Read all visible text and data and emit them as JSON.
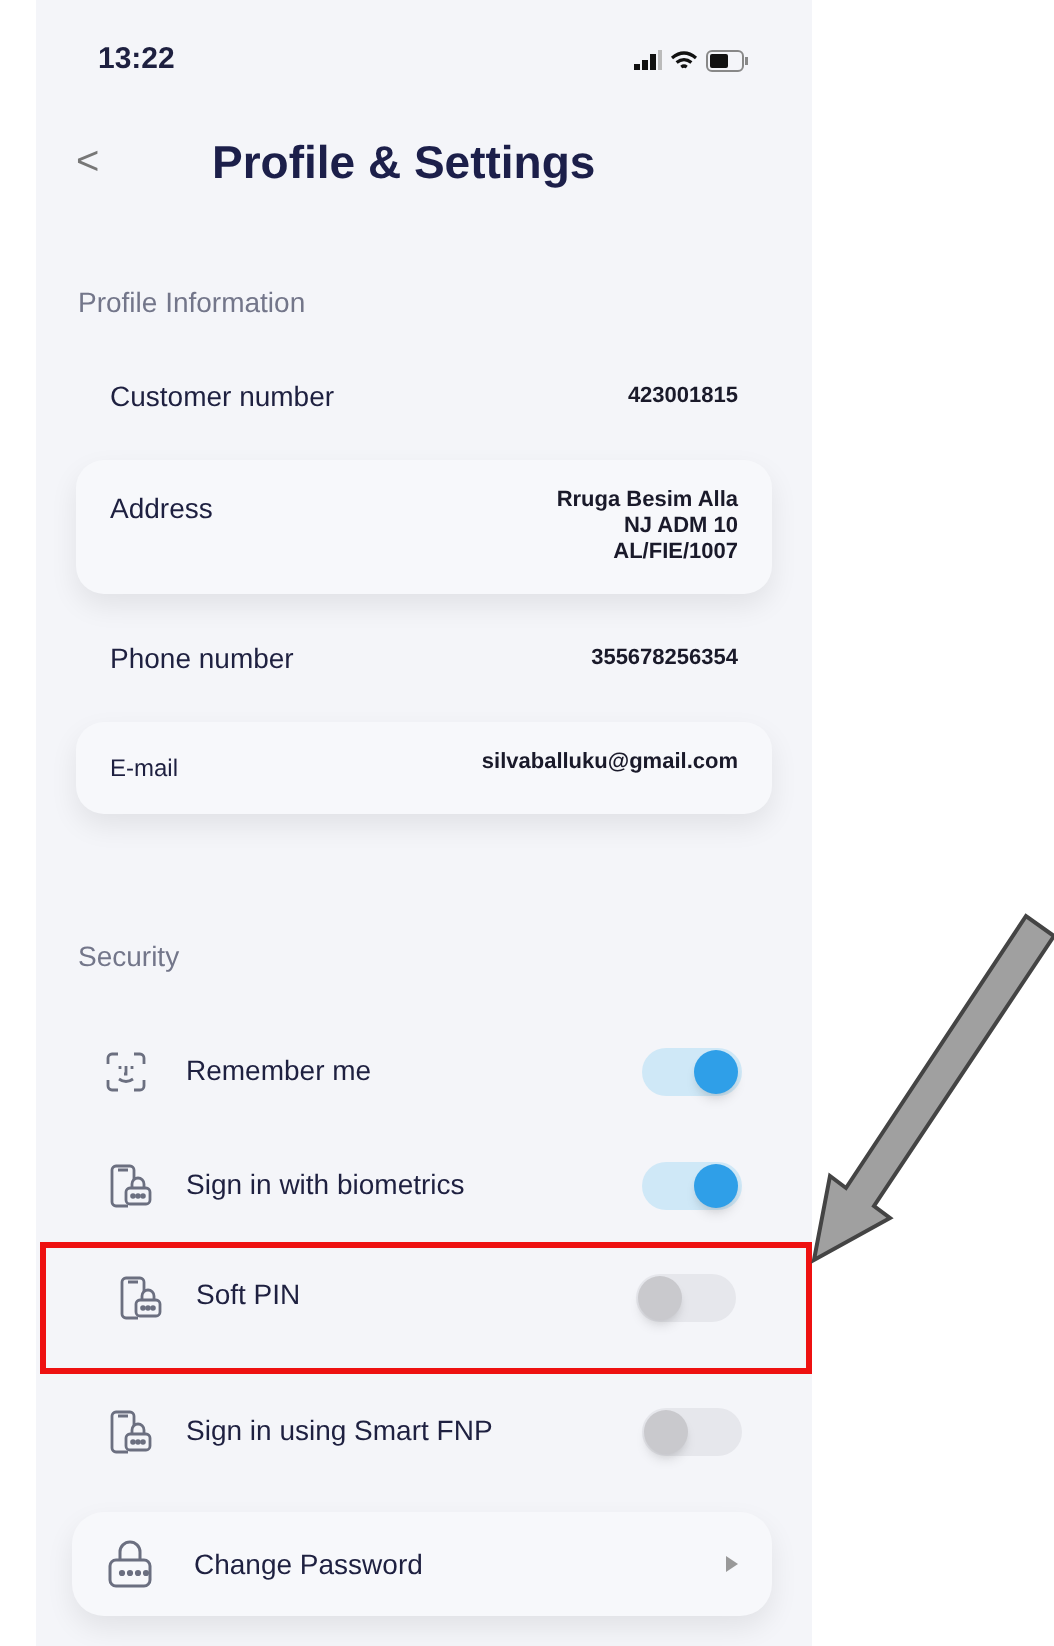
{
  "status_bar": {
    "time": "13:22"
  },
  "header": {
    "back": "<",
    "title": "Profile & Settings"
  },
  "profile_section": {
    "title": "Profile Information",
    "rows": [
      {
        "kind": "plain",
        "label": "Customer number",
        "value": [
          "423001815"
        ]
      },
      {
        "kind": "card",
        "label": "Address",
        "value": [
          "Rruga Besim Alla",
          "NJ ADM 10",
          "AL/FIE/1007"
        ]
      },
      {
        "kind": "plain",
        "label": "Phone number",
        "value": [
          "355678256354"
        ]
      },
      {
        "kind": "card",
        "label": "E-mail",
        "value": [
          "silvaballuku@gmail.com"
        ]
      }
    ]
  },
  "security_section": {
    "title": "Security",
    "items": [
      {
        "kind": "face",
        "label": "Remember me",
        "on": true,
        "highlighted": false
      },
      {
        "kind": "phone-lock",
        "label": "Sign in with biometrics",
        "on": true,
        "highlighted": false
      },
      {
        "kind": "phone-lock",
        "label": "Soft PIN",
        "on": false,
        "highlighted": true
      },
      {
        "kind": "phone-lock",
        "label": "Sign in using Smart FNP",
        "on": false,
        "highlighted": false
      }
    ],
    "link": {
      "label": "Change Password"
    }
  }
}
